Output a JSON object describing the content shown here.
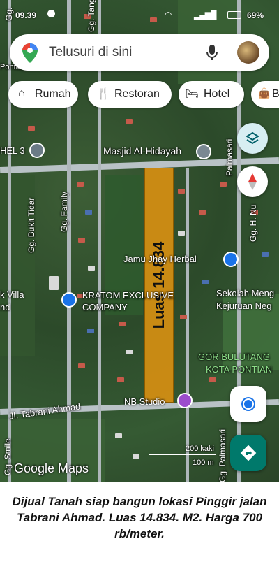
{
  "status_bar": {
    "time": "09.39",
    "battery": "69%"
  },
  "search": {
    "placeholder": "Telusuri di sini"
  },
  "chips": [
    {
      "label": "Rumah",
      "icon": "home-icon"
    },
    {
      "label": "Restoran",
      "icon": "restaurant-icon"
    },
    {
      "label": "Hotel",
      "icon": "hotel-icon"
    },
    {
      "label": "B",
      "icon": "shopping-bag-icon"
    }
  ],
  "places": {
    "mosque": "Masjid Al-Hidayah",
    "herbal": "Jamu Jhay Herbal",
    "kratom_line1": "KRATOM EXCLUSIVE",
    "kratom_line2": "COMPANY",
    "school_line1": "Sekolah Meng",
    "school_line2": "Kejuruan Neg",
    "gor_line1": "GOR BULUTANG",
    "gor_line2": "KOTA PONTIAN",
    "nb_studio": "NB Studio",
    "villa_line1": "k Villa",
    "villa_line2": "nd",
    "hotel3": "HEL 3",
    "pontian_top": "Pontian"
  },
  "streets": {
    "family": "Gg. Family",
    "bukit_tidar": "Gg. Bukit Tidar",
    "tabrani": "Jl. Tabrani Ahmad",
    "smile": "Gg. Smile",
    "palmasari_right": "Palmasari",
    "palmasari_bottom": "Gg. Palmasari",
    "h_nu": "Gg. H. Nu",
    "tang": "Gg. Tang",
    "gg_top": "Gg."
  },
  "plot_label": "Luas 14.834",
  "scale": {
    "feet": "200 kaki",
    "meters": "100 m"
  },
  "google_logo": "Google Maps",
  "caption": "Dijual Tanah siap bangun lokasi Pinggir jalan Tabrani Ahmad. Luas 14.834. M2. Harga 700 rb/meter.",
  "colors": {
    "plot_fill": "#d68f12",
    "poi_blue": "#1a73e8",
    "poi_purple": "#9c4dcc",
    "fab_teal": "#00796b"
  }
}
